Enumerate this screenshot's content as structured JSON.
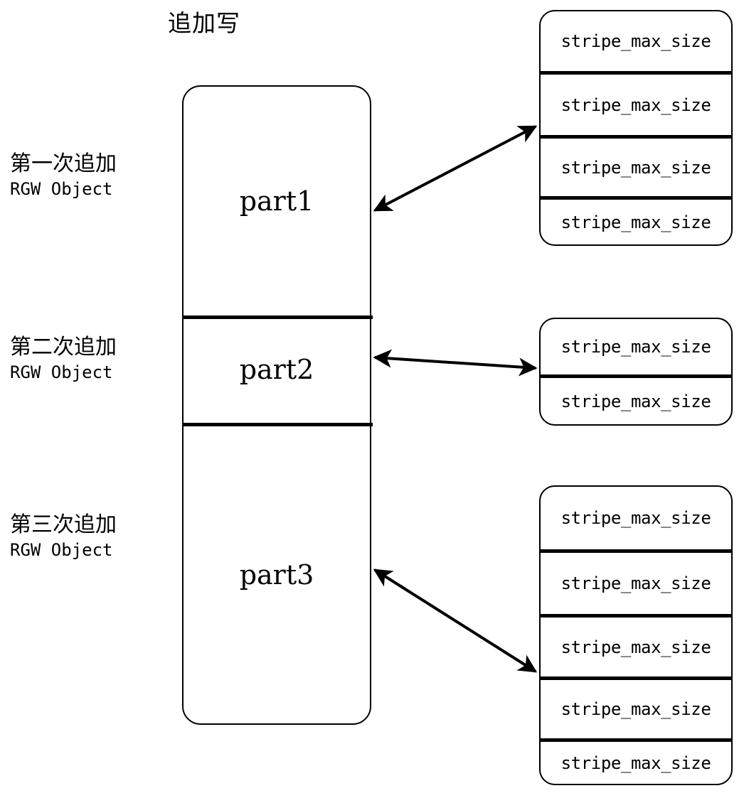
{
  "title": "追加写",
  "stages": [
    {
      "cn": "第一次追加",
      "en": "RGW Object"
    },
    {
      "cn": "第二次追加",
      "en": "RGW Object"
    },
    {
      "cn": "第三次追加",
      "en": "RGW Object"
    }
  ],
  "object_parts": [
    {
      "label": "part1"
    },
    {
      "label": "part2"
    },
    {
      "label": "part3"
    }
  ],
  "stripe_groups": [
    {
      "rows": [
        {
          "label": "stripe_max_size"
        },
        {
          "label": "stripe_max_size"
        },
        {
          "label": "stripe_max_size"
        },
        {
          "label": "stripe_max_size"
        }
      ]
    },
    {
      "rows": [
        {
          "label": "stripe_max_size"
        },
        {
          "label": "stripe_max_size"
        }
      ]
    },
    {
      "rows": [
        {
          "label": "stripe_max_size"
        },
        {
          "label": "stripe_max_size"
        },
        {
          "label": "stripe_max_size"
        },
        {
          "label": "stripe_max_size"
        },
        {
          "label": "stripe_max_size"
        }
      ]
    }
  ],
  "connectors": [
    {
      "name": "part1-to-stripe-group-1"
    },
    {
      "name": "part2-to-stripe-group-2"
    },
    {
      "name": "part3-to-stripe-group-3"
    }
  ],
  "colors": {
    "stroke": "#000000",
    "background": "#ffffff"
  }
}
